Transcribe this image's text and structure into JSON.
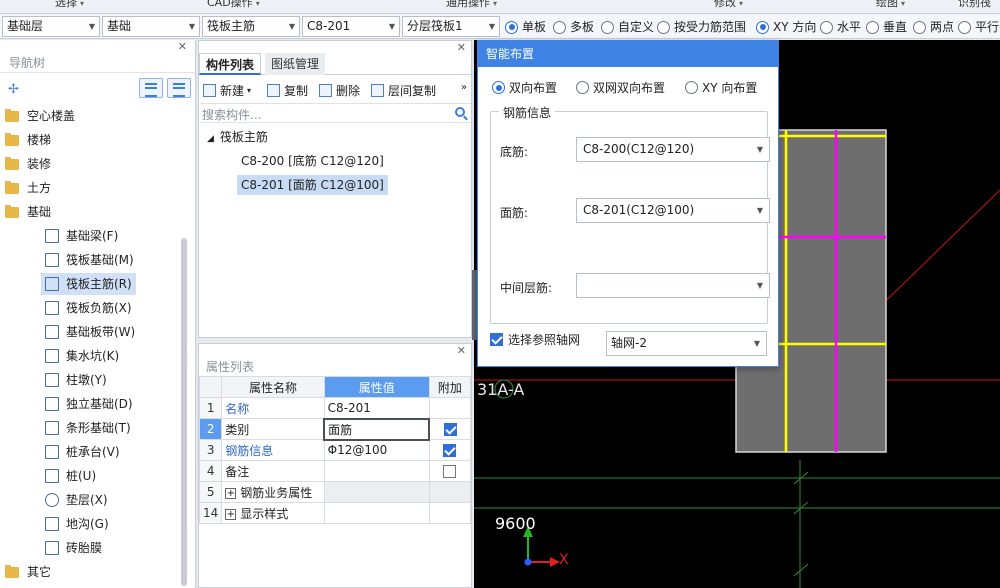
{
  "ribbon": {
    "labels": [
      "选择",
      "CAD操作",
      "通用操作",
      "修改",
      "绘图",
      "识别筏"
    ]
  },
  "toolbar": {
    "floor": "基础层",
    "category": "基础",
    "component_type": "筏板主筋",
    "component": "C8-201",
    "layer": "分层筏板1",
    "radios": [
      {
        "label": "单板",
        "checked": true
      },
      {
        "label": "多板",
        "checked": false
      },
      {
        "label": "自定义",
        "checked": false
      },
      {
        "label": "按受力筋范围",
        "checked": false
      },
      {
        "label": "XY 方向",
        "checked": true
      },
      {
        "label": "水平",
        "checked": false
      },
      {
        "label": "垂直",
        "checked": false
      },
      {
        "label": "两点",
        "checked": false
      },
      {
        "label": "平行",
        "checked": false
      }
    ]
  },
  "nav": {
    "title": "导航树",
    "items": [
      {
        "label": "空心楼盖",
        "kind": "folder"
      },
      {
        "label": "楼梯",
        "kind": "folder"
      },
      {
        "label": "装修",
        "kind": "folder"
      },
      {
        "label": "土方",
        "kind": "folder"
      },
      {
        "label": "基础",
        "kind": "folder"
      },
      {
        "label": "基础梁(F)",
        "kind": "child"
      },
      {
        "label": "筏板基础(M)",
        "kind": "child"
      },
      {
        "label": "筏板主筋(R)",
        "kind": "child",
        "selected": true
      },
      {
        "label": "筏板负筋(X)",
        "kind": "child"
      },
      {
        "label": "基础板带(W)",
        "kind": "child"
      },
      {
        "label": "集水坑(K)",
        "kind": "child"
      },
      {
        "label": "柱墩(Y)",
        "kind": "child"
      },
      {
        "label": "独立基础(D)",
        "kind": "child"
      },
      {
        "label": "条形基础(T)",
        "kind": "child"
      },
      {
        "label": "桩承台(V)",
        "kind": "child"
      },
      {
        "label": "桩(U)",
        "kind": "child"
      },
      {
        "label": "垫层(X)",
        "kind": "child"
      },
      {
        "label": "地沟(G)",
        "kind": "child"
      },
      {
        "label": "砖胎膜",
        "kind": "child"
      },
      {
        "label": "其它",
        "kind": "folder"
      }
    ]
  },
  "component_list": {
    "tabs": [
      "构件列表",
      "图纸管理"
    ],
    "tools": [
      "新建",
      "复制",
      "删除",
      "层间复制"
    ],
    "search_placeholder": "搜索构件...",
    "group": "筏板主筋",
    "items": [
      {
        "label": "C8-200 [底筋 C12@120]",
        "selected": false
      },
      {
        "label": "C8-201 [面筋 C12@100]",
        "selected": true
      }
    ]
  },
  "properties": {
    "title": "属性列表",
    "headers": [
      "属性名称",
      "属性值",
      "附加"
    ],
    "rows": [
      {
        "no": "1",
        "name": "名称",
        "value": "C8-201",
        "addon": null,
        "blue": true
      },
      {
        "no": "2",
        "name": "类别",
        "value": "面筋",
        "addon": true,
        "blue": false,
        "current": true
      },
      {
        "no": "3",
        "name": "钢筋信息",
        "value": "Φ12@100",
        "addon": true,
        "blue": true
      },
      {
        "no": "4",
        "name": "备注",
        "value": "",
        "addon": false,
        "blue": false
      },
      {
        "no": "5",
        "name": "钢筋业务属性",
        "value": "",
        "addon": null,
        "group": true
      },
      {
        "no": "14",
        "name": "显示样式",
        "value": "",
        "addon": null,
        "group": true
      }
    ]
  },
  "dialog": {
    "title": "智能布置",
    "layout_options": [
      {
        "label": "双向布置",
        "checked": true
      },
      {
        "label": "双网双向布置",
        "checked": false
      },
      {
        "label": "XY 向布置",
        "checked": false
      }
    ],
    "group_title": "钢筋信息",
    "bottom_label": "底筋:",
    "bottom_value": "C8-200(C12@120)",
    "top_label": "面筋:",
    "top_value": "C8-201(C12@100)",
    "middle_label": "中间层筋:",
    "middle_value": "",
    "ref_grid_label": "选择参照轴网",
    "ref_grid_checked": true,
    "grid_value": "轴网-2"
  },
  "canvas": {
    "axis_label": "31A-A",
    "dimension": "9600",
    "x_label": "X",
    "colors": {
      "slab": "#6e6e6e",
      "yellow_rebar": "#ffff00",
      "magenta_rebar": "#ff00ff",
      "red_line": "#c81414",
      "green_line": "#2e8b3a"
    }
  }
}
